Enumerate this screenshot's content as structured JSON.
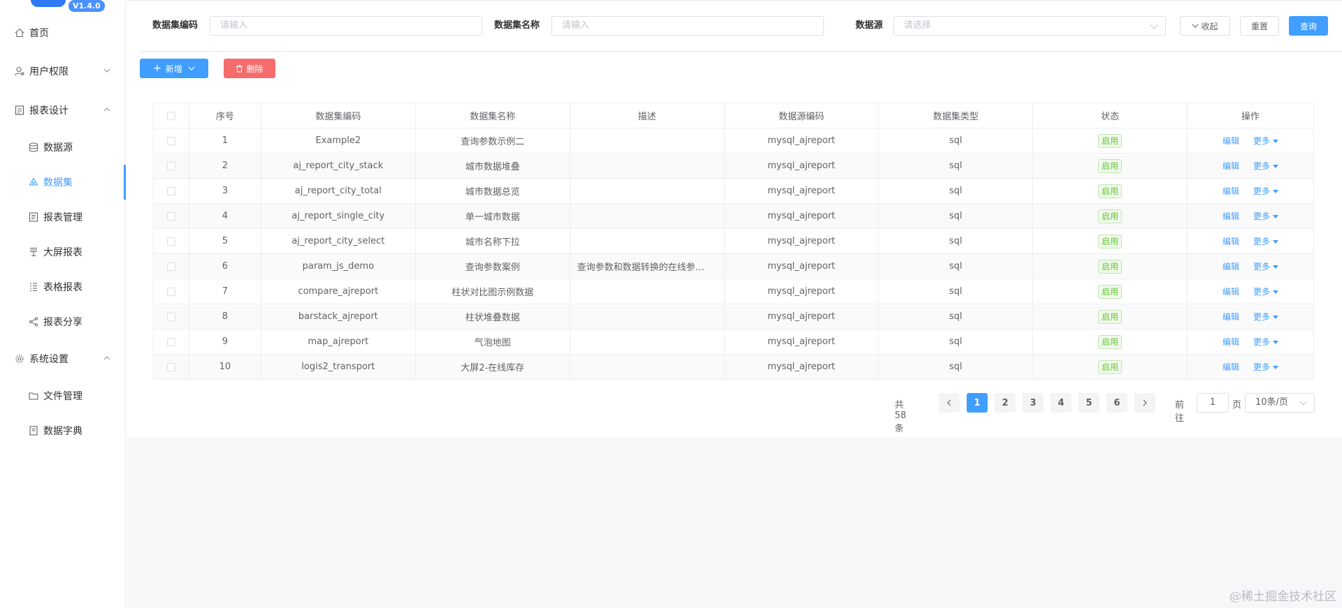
{
  "app": {
    "version": "V1.4.0"
  },
  "sidebar": {
    "items": [
      {
        "label": "首页",
        "icon": "home-icon"
      },
      {
        "label": "用户权限",
        "icon": "user-icon"
      },
      {
        "label": "报表设计",
        "icon": "report-design-icon"
      },
      {
        "label": "数据源",
        "icon": "database-icon"
      },
      {
        "label": "数据集",
        "icon": "dataset-icon"
      },
      {
        "label": "报表管理",
        "icon": "report-manage-icon"
      },
      {
        "label": "大屏报表",
        "icon": "screen-icon"
      },
      {
        "label": "表格报表",
        "icon": "table-icon"
      },
      {
        "label": "报表分享",
        "icon": "share-icon"
      },
      {
        "label": "系统设置",
        "icon": "gear-icon"
      },
      {
        "label": "文件管理",
        "icon": "folder-icon"
      },
      {
        "label": "数据字典",
        "icon": "dictionary-icon"
      }
    ]
  },
  "search": {
    "code_label": "数据集编码",
    "code_placeholder": "请输入",
    "name_label": "数据集名称",
    "name_placeholder": "请输入",
    "source_label": "数据源",
    "source_placeholder": "请选择",
    "collapse_label": "收起",
    "reset_label": "重置",
    "query_label": "查询"
  },
  "toolbar": {
    "add_label": "新增",
    "delete_label": "删除"
  },
  "table": {
    "headers": [
      "序号",
      "数据集编码",
      "数据集名称",
      "描述",
      "数据源编码",
      "数据集类型",
      "状态",
      "操作"
    ],
    "rows": [
      {
        "no": "1",
        "code": "Example2",
        "name": "查询参数示例二",
        "desc": "",
        "source": "mysql_ajreport",
        "type": "sql",
        "status": "启用"
      },
      {
        "no": "2",
        "code": "aj_report_city_stack",
        "name": "城市数据堆叠",
        "desc": "",
        "source": "mysql_ajreport",
        "type": "sql",
        "status": "启用"
      },
      {
        "no": "3",
        "code": "aj_report_city_total",
        "name": "城市数据总览",
        "desc": "",
        "source": "mysql_ajreport",
        "type": "sql",
        "status": "启用"
      },
      {
        "no": "4",
        "code": "aj_report_single_city",
        "name": "单一城市数据",
        "desc": "",
        "source": "mysql_ajreport",
        "type": "sql",
        "status": "启用"
      },
      {
        "no": "5",
        "code": "aj_report_city_select",
        "name": "城市名称下拉",
        "desc": "",
        "source": "mysql_ajreport",
        "type": "sql",
        "status": "启用"
      },
      {
        "no": "6",
        "code": "param_js_demo",
        "name": "查询参数案例",
        "desc": "查询参数和数据转换的在线参…",
        "source": "mysql_ajreport",
        "type": "sql",
        "status": "启用"
      },
      {
        "no": "7",
        "code": "compare_ajreport",
        "name": "柱状对比图示例数据",
        "desc": "",
        "source": "mysql_ajreport",
        "type": "sql",
        "status": "启用"
      },
      {
        "no": "8",
        "code": "barstack_ajreport",
        "name": "柱状堆叠数据",
        "desc": "",
        "source": "mysql_ajreport",
        "type": "sql",
        "status": "启用"
      },
      {
        "no": "9",
        "code": "map_ajreport",
        "name": "气泡地图",
        "desc": "",
        "source": "mysql_ajreport",
        "type": "sql",
        "status": "启用"
      },
      {
        "no": "10",
        "code": "logis2_transport",
        "name": "大屏2-在线库存",
        "desc": "",
        "source": "mysql_ajreport",
        "type": "sql",
        "status": "启用"
      }
    ],
    "edit_label": "编辑",
    "more_label": "更多"
  },
  "pagination": {
    "total_text": "共 58 条",
    "pages": [
      "1",
      "2",
      "3",
      "4",
      "5",
      "6"
    ],
    "current": "1",
    "goto_label": "前往",
    "goto_value": "1",
    "page_unit": "页",
    "page_size": "10条/页"
  },
  "watermark": "@稀土掘金技术社区",
  "colors": {
    "primary": "#409eff",
    "danger": "#f56c6c",
    "success": "#67c23a"
  }
}
